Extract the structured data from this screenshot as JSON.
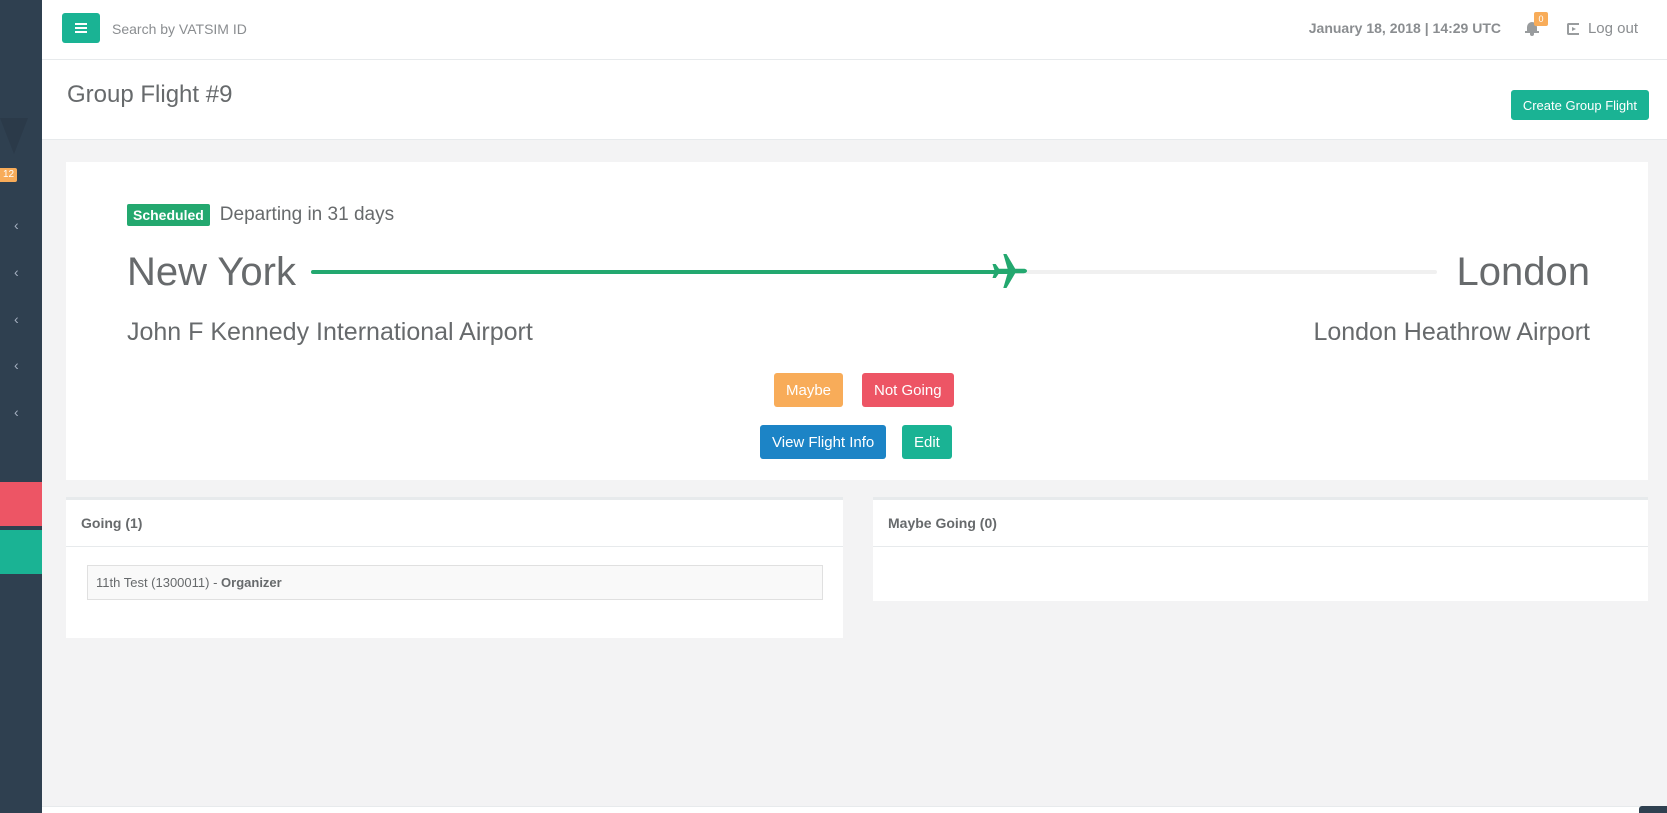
{
  "topbar": {
    "search_placeholder": "Search by VATSIM ID",
    "datetime": "January 18, 2018 | 14:29 UTC",
    "notification_count": "0",
    "logout_label": "Log out"
  },
  "sidebar": {
    "badge": "12",
    "chevrons": [
      "‹",
      "‹",
      "‹",
      "‹",
      "‹"
    ]
  },
  "heading": {
    "title": "Group Flight #9",
    "create_label": "Create Group Flight"
  },
  "flight": {
    "status_label": "Scheduled",
    "status_text": "Departing in 31 days",
    "from_city": "New York",
    "to_city": "London",
    "from_airport": "John F Kennedy International Airport",
    "to_airport": "London Heathrow Airport",
    "progress_percent": 62,
    "maybe_label": "Maybe",
    "not_going_label": "Not Going",
    "view_info_label": "View Flight Info",
    "edit_label": "Edit"
  },
  "going": {
    "title": "Going (1)",
    "attendees": [
      {
        "name": "11th Test (1300011) - ",
        "role": "Organizer"
      }
    ]
  },
  "maybe_going": {
    "title": "Maybe Going (0)"
  },
  "colors": {
    "accent": "#1ab394",
    "sidebar": "#2f4050",
    "progress": "#23a86f",
    "warning": "#f8ac59",
    "danger": "#ed5565",
    "primary": "#1c84c6"
  }
}
